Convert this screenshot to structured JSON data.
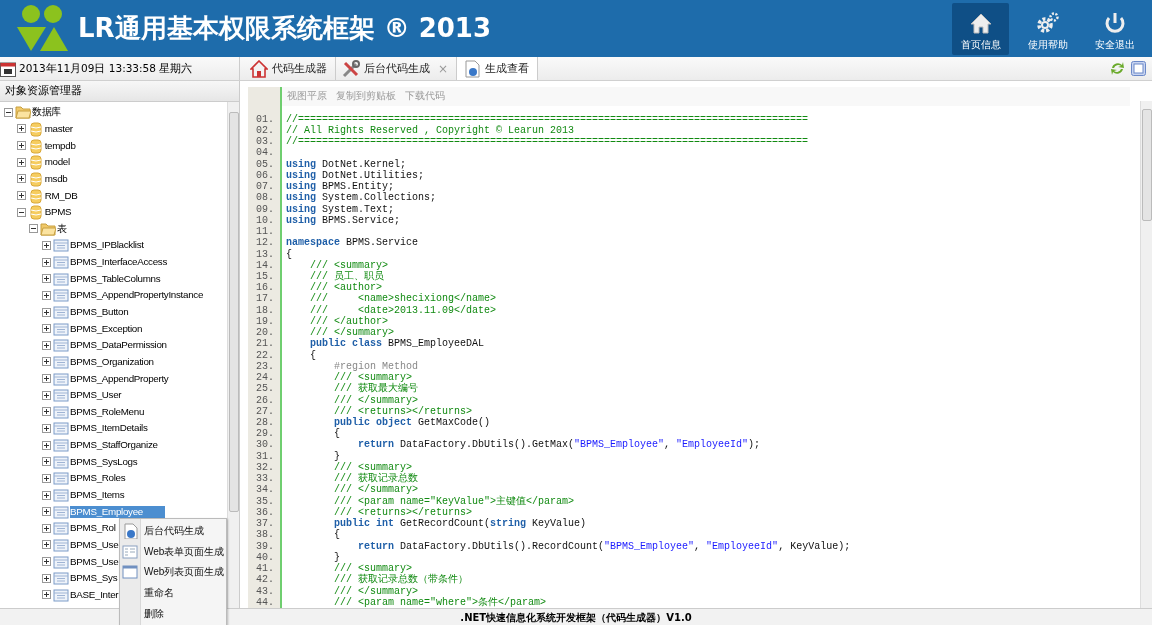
{
  "header": {
    "title": "LR通用基本权限系统框架 ® 2013",
    "nav": [
      {
        "label": "首页信息",
        "selected": true
      },
      {
        "label": "使用帮助",
        "selected": false
      },
      {
        "label": "安全退出",
        "selected": false
      }
    ]
  },
  "date": "2013年11月09日 13:33:58 星期六",
  "tabs": [
    {
      "label": "代码生成器",
      "selected": false
    },
    {
      "label": "后台代码生成",
      "selected": false,
      "close": "×"
    },
    {
      "label": "生成查看",
      "selected": true
    }
  ],
  "explorer": {
    "title": "对象资源管理器",
    "tree": [
      {
        "label": "数据库",
        "kind": "folder",
        "expanded": true,
        "selected": false,
        "children": [
          {
            "label": "master",
            "kind": "database",
            "expanded": false,
            "selected": false
          },
          {
            "label": "tempdb",
            "kind": "database",
            "expanded": false,
            "selected": false
          },
          {
            "label": "model",
            "kind": "database",
            "expanded": false,
            "selected": false
          },
          {
            "label": "msdb",
            "kind": "database",
            "expanded": false,
            "selected": false
          },
          {
            "label": "RM_DB",
            "kind": "database",
            "expanded": false,
            "selected": false
          },
          {
            "label": "BPMS",
            "kind": "database",
            "expanded": true,
            "selected": false,
            "children": [
              {
                "label": "表",
                "kind": "folder",
                "expanded": true,
                "selected": false,
                "children": [
                  {
                    "label": "BPMS_IPBlacklist",
                    "kind": "table",
                    "expanded": false,
                    "selected": false
                  },
                  {
                    "label": "BPMS_InterfaceAccess",
                    "kind": "table",
                    "expanded": false,
                    "selected": false
                  },
                  {
                    "label": "BPMS_TableColumns",
                    "kind": "table",
                    "expanded": false,
                    "selected": false
                  },
                  {
                    "label": "BPMS_AppendPropertyInstance",
                    "kind": "table",
                    "expanded": false,
                    "selected": false
                  },
                  {
                    "label": "BPMS_Button",
                    "kind": "table",
                    "expanded": false,
                    "selected": false
                  },
                  {
                    "label": "BPMS_Exception",
                    "kind": "table",
                    "expanded": false,
                    "selected": false
                  },
                  {
                    "label": "BPMS_DataPermission",
                    "kind": "table",
                    "expanded": false,
                    "selected": false
                  },
                  {
                    "label": "BPMS_Organization",
                    "kind": "table",
                    "expanded": false,
                    "selected": false
                  },
                  {
                    "label": "BPMS_AppendProperty",
                    "kind": "table",
                    "expanded": false,
                    "selected": false
                  },
                  {
                    "label": "BPMS_User",
                    "kind": "table",
                    "expanded": false,
                    "selected": false
                  },
                  {
                    "label": "BPMS_RoleMenu",
                    "kind": "table",
                    "expanded": false,
                    "selected": false
                  },
                  {
                    "label": "BPMS_ItemDetails",
                    "kind": "table",
                    "expanded": false,
                    "selected": false
                  },
                  {
                    "label": "BPMS_StaffOrganize",
                    "kind": "table",
                    "expanded": false,
                    "selected": false
                  },
                  {
                    "label": "BPMS_SysLogs",
                    "kind": "table",
                    "expanded": false,
                    "selected": false
                  },
                  {
                    "label": "BPMS_Roles",
                    "kind": "table",
                    "expanded": false,
                    "selected": false
                  },
                  {
                    "label": "BPMS_Items",
                    "kind": "table",
                    "expanded": false,
                    "selected": false
                  },
                  {
                    "label": "BPMS_Employee",
                    "kind": "table",
                    "expanded": false,
                    "selected": true
                  },
                  {
                    "label": "BPMS_Rol",
                    "kind": "table",
                    "expanded": false,
                    "selected": false
                  },
                  {
                    "label": "BPMS_Use",
                    "kind": "table",
                    "expanded": false,
                    "selected": false
                  },
                  {
                    "label": "BPMS_Use",
                    "kind": "table",
                    "expanded": false,
                    "selected": false
                  },
                  {
                    "label": "BPMS_Sys",
                    "kind": "table",
                    "expanded": false,
                    "selected": false
                  },
                  {
                    "label": "BASE_Inter",
                    "kind": "table",
                    "expanded": false,
                    "selected": false
                  }
                ]
              }
            ]
          }
        ]
      }
    ]
  },
  "context_menu": [
    "后台代码生成",
    "Web表单页面生成",
    "Web列表页面生成",
    "重命名",
    "删除"
  ],
  "code_view": {
    "toolbar": [
      "视图平原",
      "复制到剪贴板",
      "下载代码"
    ],
    "lines": [
      {
        "number": "01.",
        "segments": [
          {
            "kind": "comment",
            "text": "//====================================================================================="
          }
        ]
      },
      {
        "number": "02.",
        "segments": [
          {
            "kind": "comment",
            "text": "// All Rights Reserved , Copyright © Learun 2013"
          }
        ]
      },
      {
        "number": "03.",
        "segments": [
          {
            "kind": "comment",
            "text": "//====================================================================================="
          }
        ]
      },
      {
        "number": "04."
      },
      {
        "number": "05.",
        "segments": [
          {
            "kind": "keyword",
            "text": "using"
          },
          {
            "kind": "plain",
            "text": " DotNet.Kernel;"
          }
        ]
      },
      {
        "number": "06.",
        "segments": [
          {
            "kind": "keyword",
            "text": "using"
          },
          {
            "kind": "plain",
            "text": " DotNet.Utilities;"
          }
        ]
      },
      {
        "number": "07.",
        "segments": [
          {
            "kind": "keyword",
            "text": "using"
          },
          {
            "kind": "plain",
            "text": " BPMS.Entity;"
          }
        ]
      },
      {
        "number": "08.",
        "segments": [
          {
            "kind": "keyword",
            "text": "using"
          },
          {
            "kind": "plain",
            "text": " System.Collections;"
          }
        ]
      },
      {
        "number": "09.",
        "segments": [
          {
            "kind": "keyword",
            "text": "using"
          },
          {
            "kind": "plain",
            "text": " System.Text;"
          }
        ]
      },
      {
        "number": "10.",
        "segments": [
          {
            "kind": "keyword",
            "text": "using"
          },
          {
            "kind": "plain",
            "text": " BPMS.Service;"
          }
        ]
      },
      {
        "number": "11."
      },
      {
        "number": "12.",
        "segments": [
          {
            "kind": "keyword",
            "text": "namespace"
          },
          {
            "kind": "plain",
            "text": " BPMS.Service"
          }
        ]
      },
      {
        "number": "13.",
        "segments": [
          {
            "kind": "plain",
            "text": "{"
          }
        ]
      },
      {
        "number": "14.",
        "segments": [
          {
            "kind": "comment",
            "text": "    /// <summary>"
          }
        ]
      },
      {
        "number": "15.",
        "segments": [
          {
            "kind": "comment",
            "text": "    /// 员工、职员"
          }
        ]
      },
      {
        "number": "16.",
        "segments": [
          {
            "kind": "comment",
            "text": "    /// <author>"
          }
        ]
      },
      {
        "number": "17.",
        "segments": [
          {
            "kind": "comment",
            "text": "    ///     <name>shecixiong</name>"
          }
        ]
      },
      {
        "number": "18.",
        "segments": [
          {
            "kind": "comment",
            "text": "    ///     <date>2013.11.09</date>"
          }
        ]
      },
      {
        "number": "19.",
        "segments": [
          {
            "kind": "comment",
            "text": "    /// </author>"
          }
        ]
      },
      {
        "number": "20.",
        "segments": [
          {
            "kind": "comment",
            "text": "    /// </summary>"
          }
        ]
      },
      {
        "number": "21.",
        "segments": [
          {
            "kind": "keyword",
            "text": "    public class"
          },
          {
            "kind": "plain",
            "text": " BPMS_EmployeeDAL"
          }
        ]
      },
      {
        "number": "22.",
        "segments": [
          {
            "kind": "plain",
            "text": "    {"
          }
        ]
      },
      {
        "number": "23.",
        "segments": [
          {
            "kind": "region",
            "text": "        #region Method"
          }
        ]
      },
      {
        "number": "24.",
        "segments": [
          {
            "kind": "comment",
            "text": "        /// <summary>"
          }
        ]
      },
      {
        "number": "25.",
        "segments": [
          {
            "kind": "comment",
            "text": "        /// 获取最大编号"
          }
        ]
      },
      {
        "number": "26.",
        "segments": [
          {
            "kind": "comment",
            "text": "        /// </summary>"
          }
        ]
      },
      {
        "number": "27.",
        "segments": [
          {
            "kind": "comment",
            "text": "        /// <returns></returns>"
          }
        ]
      },
      {
        "number": "28.",
        "segments": [
          {
            "kind": "keyword",
            "text": "        public object"
          },
          {
            "kind": "plain",
            "text": " GetMaxCode()"
          }
        ]
      },
      {
        "number": "29.",
        "segments": [
          {
            "kind": "plain",
            "text": "        {"
          }
        ]
      },
      {
        "number": "30.",
        "segments": [
          {
            "kind": "keyword",
            "text": "            return"
          },
          {
            "kind": "plain",
            "text": " DataFactory.DbUtils().GetMax("
          },
          {
            "kind": "string",
            "text": "\"BPMS_Employee\""
          },
          {
            "kind": "plain",
            "text": ", "
          },
          {
            "kind": "string",
            "text": "\"EmployeeId\""
          },
          {
            "kind": "plain",
            "text": ");"
          }
        ]
      },
      {
        "number": "31.",
        "segments": [
          {
            "kind": "plain",
            "text": "        }"
          }
        ]
      },
      {
        "number": "32.",
        "segments": [
          {
            "kind": "comment",
            "text": "        /// <summary>"
          }
        ]
      },
      {
        "number": "33.",
        "segments": [
          {
            "kind": "comment",
            "text": "        /// 获取记录总数"
          }
        ]
      },
      {
        "number": "34.",
        "segments": [
          {
            "kind": "comment",
            "text": "        /// </summary>"
          }
        ]
      },
      {
        "number": "35.",
        "segments": [
          {
            "kind": "comment",
            "text": "        /// <param name=\"KeyValue\">主键值</param>"
          }
        ]
      },
      {
        "number": "36.",
        "segments": [
          {
            "kind": "comment",
            "text": "        /// <returns></returns>"
          }
        ]
      },
      {
        "number": "37.",
        "segments": [
          {
            "kind": "keyword",
            "text": "        public int"
          },
          {
            "kind": "plain",
            "text": " GetRecordCount("
          },
          {
            "kind": "keyword",
            "text": "string"
          },
          {
            "kind": "plain",
            "text": " KeyValue)"
          }
        ]
      },
      {
        "number": "38.",
        "segments": [
          {
            "kind": "plain",
            "text": "        {"
          }
        ]
      },
      {
        "number": "39.",
        "segments": [
          {
            "kind": "keyword",
            "text": "            return"
          },
          {
            "kind": "plain",
            "text": " DataFactory.DbUtils().RecordCount("
          },
          {
            "kind": "string",
            "text": "\"BPMS_Employee\""
          },
          {
            "kind": "plain",
            "text": ", "
          },
          {
            "kind": "string",
            "text": "\"EmployeeId\""
          },
          {
            "kind": "plain",
            "text": ", KeyValue);"
          }
        ]
      },
      {
        "number": "40.",
        "segments": [
          {
            "kind": "plain",
            "text": "        }"
          }
        ]
      },
      {
        "number": "41.",
        "segments": [
          {
            "kind": "comment",
            "text": "        /// <summary>"
          }
        ]
      },
      {
        "number": "42.",
        "segments": [
          {
            "kind": "comment",
            "text": "        /// 获取记录总数（带条件）"
          }
        ]
      },
      {
        "number": "43.",
        "segments": [
          {
            "kind": "comment",
            "text": "        /// </summary>"
          }
        ]
      },
      {
        "number": "44.",
        "segments": [
          {
            "kind": "comment",
            "text": "        /// <param name=\"where\">条件</param>"
          }
        ]
      }
    ]
  },
  "footer": ".NET快速信息化系统开发框架（代码生成器）V1.0"
}
